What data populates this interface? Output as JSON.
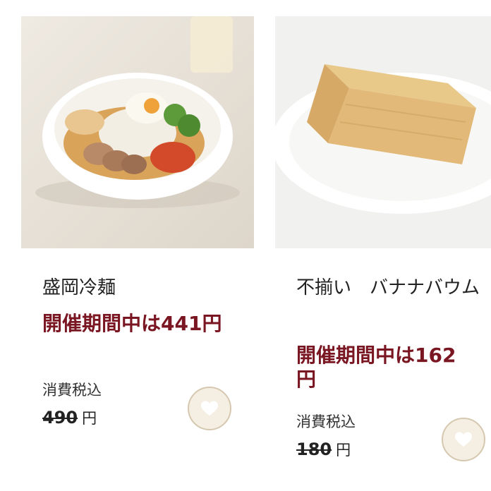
{
  "products": [
    {
      "name": "盛岡冷麺",
      "sale_text": "開催期間中は441円",
      "tax_label": "消費税込",
      "original_price": "490",
      "currency": "円"
    },
    {
      "name": "不揃い　バナナバウム",
      "sale_text": "開催期間中は162円",
      "tax_label": "消費税込",
      "original_price": "180",
      "currency": "円"
    }
  ],
  "colors": {
    "sale": "#7a1622",
    "favorite_bg": "#f5efe3",
    "favorite_border": "#d6c8b0"
  },
  "icons": {
    "favorite": "heart-icon"
  }
}
